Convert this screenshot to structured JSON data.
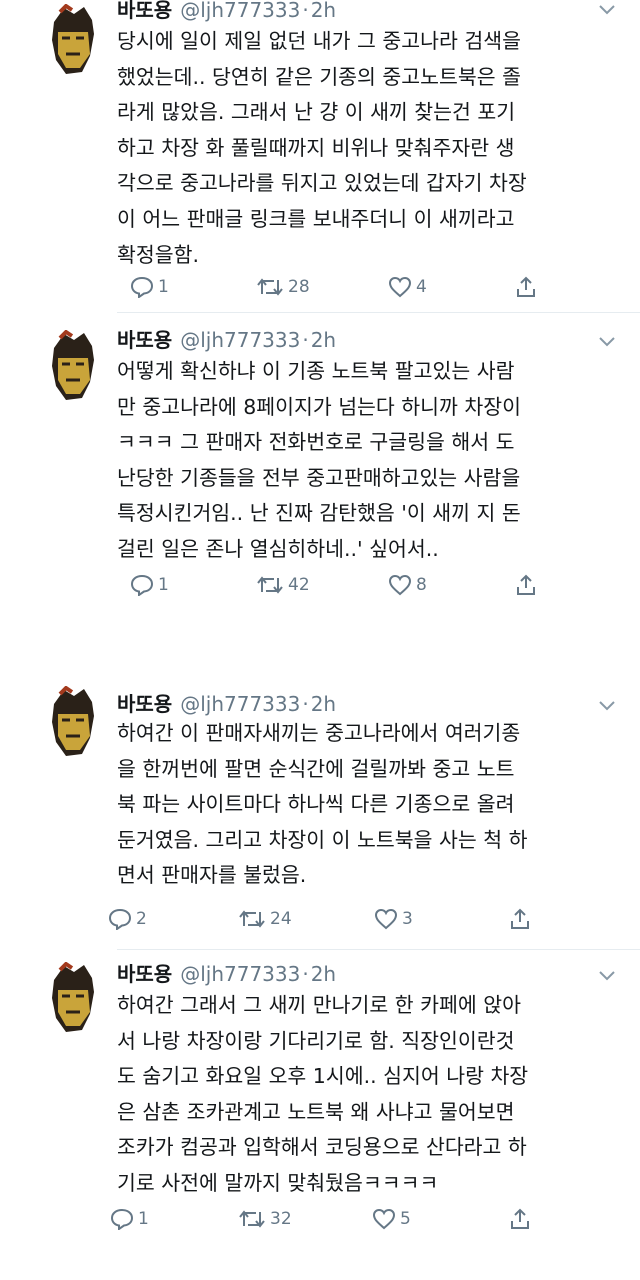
{
  "tweets": [
    {
      "name": "바또용",
      "handle": "@ljh777333",
      "dot": "·",
      "time": "2h",
      "lines": [
        "당시에 일이 제일 없던 내가 그 중고나라 검색을",
        "했었는데.. 당연히 같은 기종의 중고노트북은 졸",
        "라게 많았음. 그래서 난 걍 이 새끼 찾는건 포기",
        "하고 차장 화 풀릴때까지 비위나 맞춰주자란 생",
        "각으로 중고나라를 뒤지고 있었는데 갑자기 차장",
        "이 어느 판매글 링크를 보내주더니 이 새끼라고",
        "확정을함."
      ],
      "replies": "1",
      "retweets": "28",
      "likes": "4"
    },
    {
      "name": "바또용",
      "handle": "@ljh777333",
      "dot": "·",
      "time": "2h",
      "lines": [
        "어떻게 확신하냐 이 기종 노트북 팔고있는 사람",
        "만 중고나라에 8페이지가 넘는다 하니까 차장이",
        "ㅋㅋㅋ 그 판매자 전화번호로 구글링을 해서 도",
        "난당한 기종들을 전부 중고판매하고있는 사람을",
        "특정시킨거임.. 난 진짜 감탄했음 '이 새끼 지 돈",
        "걸린 일은 존나 열심히하네..' 싶어서.."
      ],
      "replies": "1",
      "retweets": "42",
      "likes": "8"
    },
    {
      "name": "바또용",
      "handle": "@ljh777333",
      "dot": "·",
      "time": "2h",
      "lines": [
        "하여간 이 판매자새끼는 중고나라에서 여러기종",
        "을 한꺼번에 팔면 순식간에 걸릴까봐 중고 노트",
        "북 파는 사이트마다 하나씩 다른 기종으로 올려",
        "둔거였음. 그리고 차장이 이 노트북을 사는 척 하",
        "면서 판매자를 불렀음."
      ],
      "replies": "2",
      "retweets": "24",
      "likes": "3"
    },
    {
      "name": "바또용",
      "handle": "@ljh777333",
      "dot": "·",
      "time": "2h",
      "lines": [
        "하여간 그래서 그 새끼 만나기로 한 카페에 앉아",
        "서 나랑 차장이랑 기다리기로 함. 직장인이란것",
        "도 숨기고 화요일 오후 1시에.. 심지어 나랑 차장",
        "은 삼촌 조카관계고 노트북 왜 사냐고 물어보면",
        "조카가 컴공과 입학해서 코딩용으로 산다라고 하",
        "기로 사전에 말까지 맞춰뒀음ㅋㅋㅋㅋ"
      ],
      "replies": "1",
      "retweets": "32",
      "likes": "5"
    }
  ],
  "icons": {
    "reply": "reply-icon",
    "retweet": "retweet-icon",
    "like": "heart-icon",
    "share": "share-icon",
    "more": "chevron-down-icon",
    "avatar": "avatar"
  },
  "colors": {
    "text": "#14171a",
    "secondary": "#657786",
    "divider": "#e6ecf0",
    "background": "#ffffff"
  }
}
